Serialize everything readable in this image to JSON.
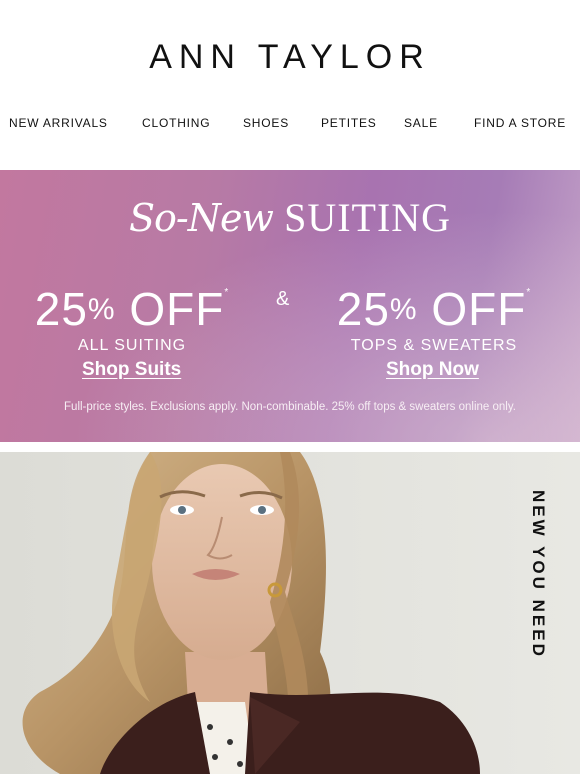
{
  "brand": {
    "name": "ANN TAYLOR"
  },
  "nav": {
    "items": [
      {
        "label": "NEW ARRIVALS"
      },
      {
        "label": "CLOTHING"
      },
      {
        "label": "SHOES"
      },
      {
        "label": "PETITES"
      },
      {
        "label": "SALE"
      },
      {
        "label": "FIND A STORE"
      }
    ]
  },
  "promo": {
    "title_script": "So-New",
    "title_caps": "SUITING",
    "offers": [
      {
        "percent": "25",
        "pct_sign": "%",
        "off": "OFF",
        "mark": "*",
        "subtitle": "ALL SUITING",
        "cta": "Shop Suits"
      },
      {
        "percent": "25",
        "pct_sign": "%",
        "off": "OFF",
        "mark": "*",
        "subtitle": "TOPS & SWEATERS",
        "cta": "Shop Now"
      }
    ],
    "connector": "&",
    "disclaimer": "Full-price styles. Exclusions apply. Non-combinable. 25% off tops & sweaters online only.",
    "colors": {
      "gradient_start": "#c2789f",
      "gradient_mid": "#a873b0",
      "gradient_end": "#c5a3c9",
      "text": "#ffffff"
    }
  },
  "hero": {
    "side_text": "NEW YOU NEED",
    "image": "model-portrait-brown-blazer",
    "background": "#e3e4df"
  }
}
